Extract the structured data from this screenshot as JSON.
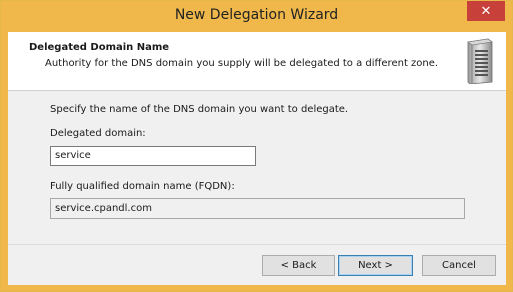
{
  "window": {
    "title": "New Delegation Wizard",
    "close_glyph": "✕"
  },
  "header": {
    "title": "Delegated Domain Name",
    "subtitle": "Authority for the DNS domain you supply will be delegated to a different zone.",
    "icon": "server-icon"
  },
  "body": {
    "instructions": "Specify the name of the DNS domain you want to delegate.",
    "delegated_label": "Delegated domain:",
    "delegated_value": "service",
    "fqdn_label": "Fully qualified domain name (FQDN):",
    "fqdn_value": "service.cpandl.com"
  },
  "buttons": {
    "back": "< Back",
    "next": "Next >",
    "cancel": "Cancel"
  },
  "colors": {
    "title_bar": "#f0b84b",
    "close": "#c7403a",
    "default_button_border": "#3c7fb1"
  }
}
